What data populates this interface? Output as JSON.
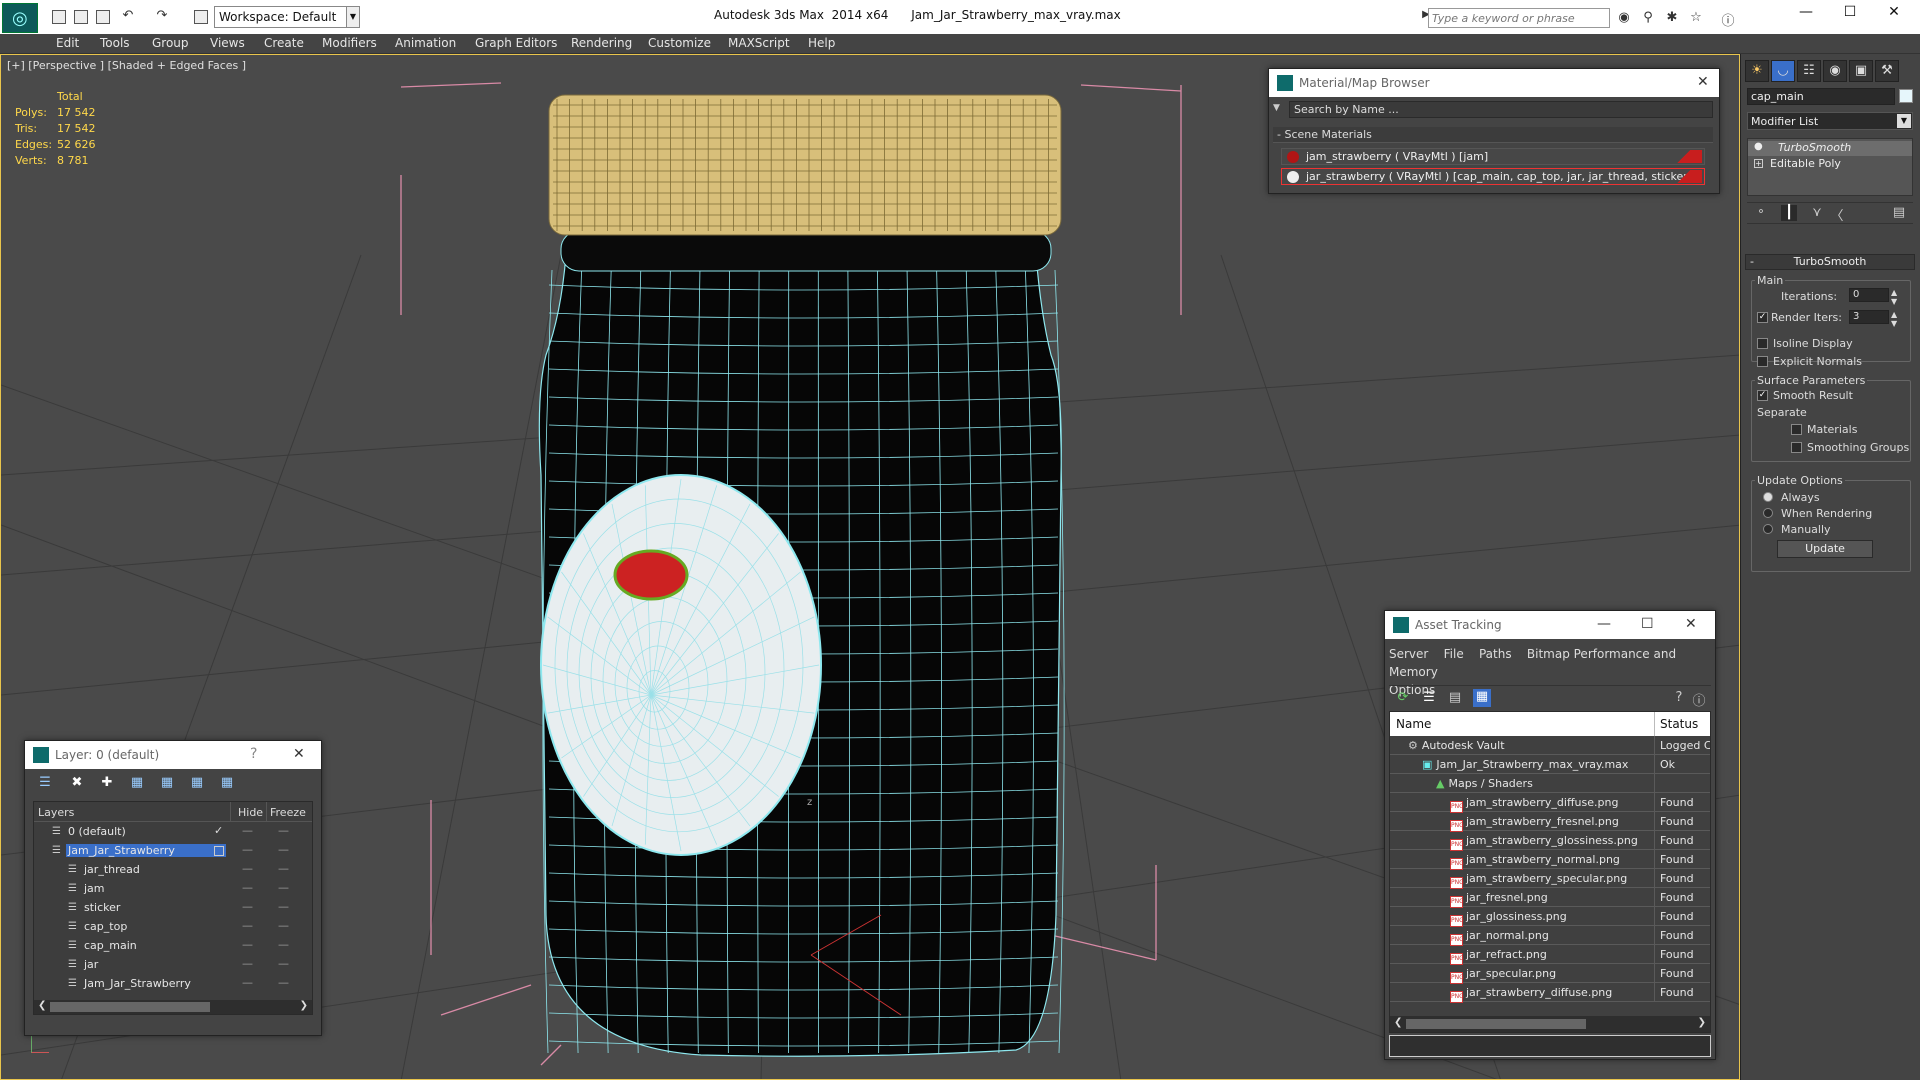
{
  "window": {
    "app_title": "Autodesk 3ds Max  2014 x64",
    "file_title": "Jam_Jar_Strawberry_max_vray.max",
    "workspace": "Workspace: Default",
    "search_placeholder": "Type a keyword or phrase"
  },
  "menu": [
    "Edit",
    "Tools",
    "Group",
    "Views",
    "Create",
    "Modifiers",
    "Animation",
    "Graph Editors",
    "Rendering",
    "Customize",
    "MAXScript",
    "Help"
  ],
  "viewport": {
    "label": "[+] [Perspective ] [Shaded + Edged Faces ]",
    "stats_header": "Total",
    "stats": [
      {
        "k": "Polys:",
        "v": "17 542"
      },
      {
        "k": "Tris:",
        "v": "17 542"
      },
      {
        "k": "Edges:",
        "v": "52 626"
      },
      {
        "k": "Verts:",
        "v": "8 781"
      }
    ],
    "axis_label": "z"
  },
  "material_browser": {
    "title": "Material/Map Browser",
    "search": "Search by Name ...",
    "section": "- Scene Materials",
    "items": [
      "jam_strawberry  ( VRayMtl )  [jam]",
      "jar_strawberry  ( VRayMtl )  [cap_main, cap_top, jar, jar_thread, sticker]"
    ]
  },
  "layers": {
    "title": "Layer: 0 (default)",
    "help": "?",
    "headers": {
      "name": "Layers",
      "hide": "Hide",
      "freeze": "Freeze"
    },
    "rows": [
      {
        "name": "0 (default)",
        "indent": 0
      },
      {
        "name": "Jam_Jar_Strawberry",
        "indent": 0
      },
      {
        "name": "jar_thread",
        "indent": 1
      },
      {
        "name": "jam",
        "indent": 1
      },
      {
        "name": "sticker",
        "indent": 1
      },
      {
        "name": "cap_top",
        "indent": 1
      },
      {
        "name": "cap_main",
        "indent": 1
      },
      {
        "name": "jar",
        "indent": 1
      },
      {
        "name": "Jam_Jar_Strawberry",
        "indent": 1
      }
    ]
  },
  "asset_tracking": {
    "title": "Asset Tracking",
    "menu": [
      "Server",
      "File",
      "Paths",
      "Bitmap Performance and Memory",
      "Options"
    ],
    "headers": {
      "name": "Name",
      "status": "Status"
    },
    "rows": [
      {
        "name": "Autodesk Vault",
        "status": "Logged C",
        "indent": 1
      },
      {
        "name": "Jam_Jar_Strawberry_max_vray.max",
        "status": "Ok",
        "indent": 2
      },
      {
        "name": "Maps / Shaders",
        "status": "",
        "indent": 3
      },
      {
        "name": "jam_strawberry_diffuse.png",
        "status": "Found",
        "indent": 4
      },
      {
        "name": "jam_strawberry_fresnel.png",
        "status": "Found",
        "indent": 4
      },
      {
        "name": "jam_strawberry_glossiness.png",
        "status": "Found",
        "indent": 4
      },
      {
        "name": "jam_strawberry_normal.png",
        "status": "Found",
        "indent": 4
      },
      {
        "name": "jam_strawberry_specular.png",
        "status": "Found",
        "indent": 4
      },
      {
        "name": "jar_fresnel.png",
        "status": "Found",
        "indent": 4
      },
      {
        "name": "jar_glossiness.png",
        "status": "Found",
        "indent": 4
      },
      {
        "name": "jar_normal.png",
        "status": "Found",
        "indent": 4
      },
      {
        "name": "jar_refract.png",
        "status": "Found",
        "indent": 4
      },
      {
        "name": "jar_specular.png",
        "status": "Found",
        "indent": 4
      },
      {
        "name": "jar_strawberry_diffuse.png",
        "status": "Found",
        "indent": 4
      }
    ]
  },
  "command_panel": {
    "object_name": "cap_main",
    "modifier_list": "Modifier List",
    "stack": [
      "TurboSmooth",
      "Editable Poly"
    ],
    "rollout_title": "TurboSmooth",
    "main_label": "Main",
    "iterations_label": "Iterations:",
    "iterations": "0",
    "render_iters_label": "Render Iters:",
    "render_iters": "3",
    "isoline": "Isoline Display",
    "explicit_normals": "Explicit Normals",
    "surface_params": "Surface Parameters",
    "smooth_result": "Smooth Result",
    "separate": "Separate",
    "materials": "Materials",
    "smoothing_groups": "Smoothing Groups",
    "update_options": "Update Options",
    "always": "Always",
    "when_rendering": "When Rendering",
    "manually": "Manually",
    "update_button": "Update"
  }
}
